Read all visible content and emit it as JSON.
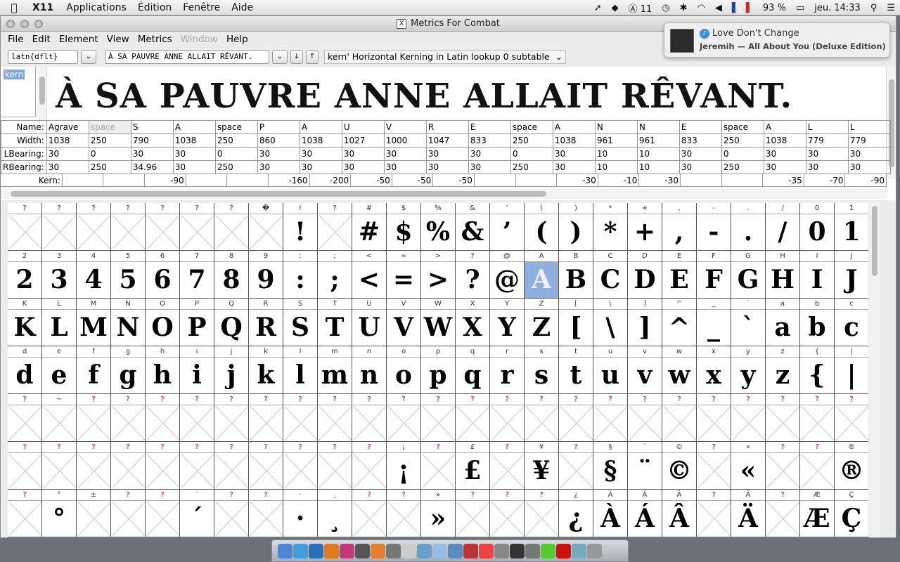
{
  "menubar": {
    "app_name": "X11",
    "items": [
      "Applications",
      "Édition",
      "Fenêtre",
      "Aide"
    ],
    "status_count": "11",
    "battery": "93 %",
    "clock": "jeu. 14:33"
  },
  "window": {
    "title": "Metrics For Combat",
    "menu": [
      "File",
      "Edit",
      "Element",
      "View",
      "Metrics",
      "Window",
      "Help"
    ],
    "script_field": "latn{dflt}",
    "text_field": "À SA PAUVRE ANNE ALLAIT RÊVANT.",
    "lookup_select": "kern' Horizontal Kerning in Latin lookup 0 subtable",
    "feature_list": [
      "kern"
    ],
    "preview_text": "À SA PAUVRE ANNE ALLAIT RÊVANT."
  },
  "metrics": {
    "row_labels": [
      "Name:",
      "Width:",
      "LBearing:",
      "RBearing:"
    ],
    "kern_label": "Kern:",
    "names": [
      "Agrave",
      "space",
      "S",
      "A",
      "space",
      "P",
      "A",
      "U",
      "V",
      "R",
      "E",
      "space",
      "A",
      "N",
      "N",
      "E",
      "space",
      "A",
      "L",
      "L"
    ],
    "widths": [
      "1038",
      "250",
      "790",
      "1038",
      "250",
      "860",
      "1038",
      "1027",
      "1000",
      "1047",
      "833",
      "250",
      "1038",
      "961",
      "961",
      "833",
      "250",
      "1038",
      "779",
      "779"
    ],
    "lbearings": [
      "30",
      "0",
      "30",
      "30",
      "0",
      "30",
      "30",
      "30",
      "30",
      "30",
      "30",
      "0",
      "30",
      "10",
      "10",
      "30",
      "0",
      "30",
      "30",
      "30"
    ],
    "rbearings": [
      "30",
      "250",
      "34.96",
      "30",
      "250",
      "30",
      "30",
      "30",
      "30",
      "30",
      "30",
      "250",
      "30",
      "10",
      "10",
      "30",
      "250",
      "30",
      "30",
      "30"
    ],
    "kerns": [
      "",
      "",
      "-90",
      "",
      "",
      "-160",
      "-200",
      "-50",
      "-50",
      "-50",
      "",
      "",
      "-30",
      "-10",
      "-30",
      "",
      "",
      "-35",
      "-70",
      "-90"
    ]
  },
  "notification": {
    "title": "Love Don't Change",
    "subtitle": "Jeremih — All About You (Deluxe Edition)"
  },
  "fontview": {
    "rows": [
      [
        [
          "?",
          "",
          1
        ],
        [
          "?",
          "",
          1
        ],
        [
          "?",
          "",
          1
        ],
        [
          "?",
          "",
          1
        ],
        [
          "?",
          "",
          1
        ],
        [
          "?",
          "",
          1
        ],
        [
          "?",
          "",
          1
        ],
        [
          "�",
          "",
          0
        ],
        [
          "!",
          "!",
          0
        ],
        [
          "?",
          "",
          1
        ],
        [
          "#",
          "#",
          0
        ],
        [
          "$",
          "$",
          0
        ],
        [
          "%",
          "%",
          0
        ],
        [
          "&",
          "&",
          0
        ],
        [
          "’",
          "’",
          0
        ],
        [
          "(",
          "(",
          0
        ],
        [
          ")",
          ")",
          0
        ],
        [
          "*",
          "*",
          0
        ],
        [
          "+",
          "+",
          0
        ],
        [
          ",",
          ",",
          0
        ],
        [
          "-",
          "-",
          0
        ],
        [
          ".",
          ".",
          0
        ],
        [
          "/",
          "/",
          0
        ],
        [
          "0",
          "0",
          0
        ],
        [
          "1",
          "1",
          0
        ]
      ],
      [
        [
          "2",
          "2",
          0
        ],
        [
          "3",
          "3",
          0
        ],
        [
          "4",
          "4",
          0
        ],
        [
          "5",
          "5",
          0
        ],
        [
          "6",
          "6",
          0
        ],
        [
          "7",
          "7",
          0
        ],
        [
          "8",
          "8",
          0
        ],
        [
          "9",
          "9",
          0
        ],
        [
          ":",
          ":",
          0
        ],
        [
          ";",
          ";",
          0
        ],
        [
          "<",
          "<",
          0
        ],
        [
          "=",
          "=",
          0
        ],
        [
          ">",
          ">",
          0
        ],
        [
          "?",
          "?",
          0
        ],
        [
          "@",
          "@",
          0
        ],
        [
          "A",
          "A",
          0
        ],
        [
          "B",
          "B",
          0
        ],
        [
          "C",
          "C",
          0
        ],
        [
          "D",
          "D",
          0
        ],
        [
          "E",
          "E",
          0
        ],
        [
          "F",
          "F",
          0
        ],
        [
          "G",
          "G",
          0
        ],
        [
          "H",
          "H",
          0
        ],
        [
          "I",
          "I",
          0
        ],
        [
          "J",
          "J",
          0
        ]
      ],
      [
        [
          "K",
          "K",
          0
        ],
        [
          "L",
          "L",
          0
        ],
        [
          "M",
          "M",
          0
        ],
        [
          "N",
          "N",
          0
        ],
        [
          "O",
          "O",
          0
        ],
        [
          "P",
          "P",
          0
        ],
        [
          "Q",
          "Q",
          0
        ],
        [
          "R",
          "R",
          0
        ],
        [
          "S",
          "S",
          0
        ],
        [
          "T",
          "T",
          0
        ],
        [
          "U",
          "U",
          0
        ],
        [
          "V",
          "V",
          0
        ],
        [
          "W",
          "W",
          0
        ],
        [
          "X",
          "X",
          0
        ],
        [
          "Y",
          "Y",
          0
        ],
        [
          "Z",
          "Z",
          0
        ],
        [
          "[",
          "[",
          0
        ],
        [
          "\\",
          "\\",
          0
        ],
        [
          "]",
          "]",
          0
        ],
        [
          "^",
          "^",
          0
        ],
        [
          "_",
          "_",
          0
        ],
        [
          "`",
          "`",
          0
        ],
        [
          "a",
          "a",
          0
        ],
        [
          "b",
          "b",
          0
        ],
        [
          "c",
          "c",
          0
        ]
      ],
      [
        [
          "d",
          "d",
          0
        ],
        [
          "e",
          "e",
          0
        ],
        [
          "f",
          "f",
          0
        ],
        [
          "g",
          "g",
          0
        ],
        [
          "h",
          "h",
          0
        ],
        [
          "i",
          "i",
          0
        ],
        [
          "j",
          "j",
          0
        ],
        [
          "k",
          "k",
          0
        ],
        [
          "l",
          "l",
          0
        ],
        [
          "m",
          "m",
          0
        ],
        [
          "n",
          "n",
          0
        ],
        [
          "o",
          "o",
          0
        ],
        [
          "p",
          "p",
          0
        ],
        [
          "q",
          "q",
          0
        ],
        [
          "r",
          "r",
          0
        ],
        [
          "s",
          "s",
          0
        ],
        [
          "t",
          "t",
          0
        ],
        [
          "u",
          "u",
          0
        ],
        [
          "v",
          "v",
          0
        ],
        [
          "w",
          "w",
          0
        ],
        [
          "x",
          "x",
          0
        ],
        [
          "y",
          "y",
          0
        ],
        [
          "z",
          "z",
          0
        ],
        [
          "{",
          "{",
          0
        ],
        [
          "|",
          "|",
          0
        ]
      ],
      [
        [
          "?",
          "",
          1
        ],
        [
          "~",
          "",
          0
        ],
        [
          "?",
          "",
          1
        ],
        [
          "?",
          "",
          1
        ],
        [
          "?",
          "",
          1
        ],
        [
          "?",
          "",
          1
        ],
        [
          "?",
          "",
          1
        ],
        [
          "?",
          "",
          1
        ],
        [
          "?",
          "",
          1
        ],
        [
          "?",
          "",
          1
        ],
        [
          "?",
          "",
          1
        ],
        [
          "?",
          "",
          1
        ],
        [
          "?",
          "",
          1
        ],
        [
          "?",
          "",
          1
        ],
        [
          "?",
          "",
          1
        ],
        [
          "?",
          "",
          1
        ],
        [
          "?",
          "",
          1
        ],
        [
          "?",
          "",
          1
        ],
        [
          "?",
          "",
          1
        ],
        [
          "?",
          "",
          1
        ],
        [
          "?",
          "",
          1
        ],
        [
          "?",
          "",
          1
        ],
        [
          "?",
          "",
          1
        ],
        [
          "?",
          "",
          1
        ],
        [
          "?",
          "",
          1
        ]
      ],
      [
        [
          "?",
          "",
          1
        ],
        [
          "?",
          "",
          1
        ],
        [
          "?",
          "",
          1
        ],
        [
          "?",
          "",
          1
        ],
        [
          "?",
          "",
          1
        ],
        [
          "?",
          "",
          1
        ],
        [
          "?",
          "",
          1
        ],
        [
          "?",
          "",
          1
        ],
        [
          "?",
          "",
          1
        ],
        [
          "?",
          "",
          1
        ],
        [
          "?",
          "",
          1
        ],
        [
          "¡",
          "¡",
          0
        ],
        [
          "?",
          "",
          1
        ],
        [
          "£",
          "£",
          0
        ],
        [
          "?",
          "",
          1
        ],
        [
          "¥",
          "¥",
          0
        ],
        [
          "?",
          "",
          1
        ],
        [
          "§",
          "§",
          0
        ],
        [
          "¨",
          "¨",
          0
        ],
        [
          "©",
          "©",
          0
        ],
        [
          "?",
          "",
          1
        ],
        [
          "«",
          "«",
          0
        ],
        [
          "?",
          "",
          1
        ],
        [
          "?",
          "",
          1
        ],
        [
          "®",
          "®",
          0
        ]
      ],
      [
        [
          "?",
          "",
          1
        ],
        [
          "°",
          "°",
          0
        ],
        [
          "±",
          "",
          0
        ],
        [
          "?",
          "",
          1
        ],
        [
          "?",
          "",
          1
        ],
        [
          "´",
          "´",
          0
        ],
        [
          "?",
          "",
          1
        ],
        [
          "?",
          "",
          1
        ],
        [
          "·",
          "·",
          0
        ],
        [
          "¸",
          "¸",
          0
        ],
        [
          "?",
          "",
          1
        ],
        [
          "?",
          "",
          1
        ],
        [
          "»",
          "»",
          0
        ],
        [
          "?",
          "",
          1
        ],
        [
          "?",
          "",
          1
        ],
        [
          "?",
          "",
          1
        ],
        [
          "¿",
          "¿",
          0
        ],
        [
          "À",
          "À",
          0
        ],
        [
          "Á",
          "Á",
          0
        ],
        [
          "Â",
          "Â",
          0
        ],
        [
          "?",
          "",
          1
        ],
        [
          "Ä",
          "Ä",
          0
        ],
        [
          "?",
          "",
          1
        ],
        [
          "Æ",
          "Æ",
          0
        ],
        [
          "Ç",
          "Ç",
          0
        ]
      ]
    ],
    "selected": [
      1,
      15
    ]
  },
  "dock": {
    "icons": [
      "finder-icon",
      "safari-icon",
      "photoshop-icon",
      "illustrator-icon",
      "indesign-icon",
      "font-icon",
      "blender-icon",
      "tools-icon",
      "textedit-icon",
      "preview-icon",
      "itunes-icon",
      "mail-icon",
      "photobooth-icon",
      "calendar-icon",
      "network-icon",
      "x11-icon",
      "github-icon",
      "adium-icon",
      "acrobat-icon",
      "folder-icon",
      "trash-icon"
    ],
    "icon_colors": [
      "#4d86d6",
      "#3f9fd8",
      "#2b6fb8",
      "#e07b1d",
      "#c23a7c",
      "#555",
      "#e08030",
      "#777",
      "#ccc",
      "#6aa0c8",
      "#9bd",
      "#5a8ac0",
      "#b33",
      "#e44",
      "#888",
      "#333",
      "#777",
      "#5c3",
      "#c11",
      "#7ab",
      "#999"
    ]
  }
}
